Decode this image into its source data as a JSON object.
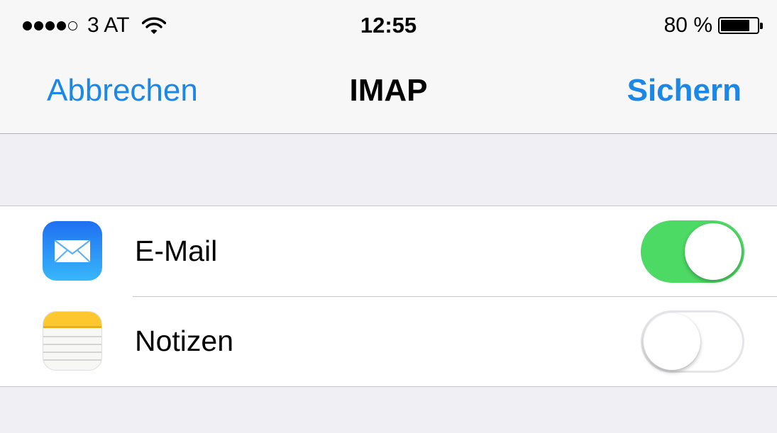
{
  "status_bar": {
    "signal_bars": 5,
    "signal_filled": 4,
    "carrier": "3 AT",
    "wifi_icon": "wifi-icon",
    "time": "12:55",
    "battery_percent": "80 %",
    "battery_level": 0.8
  },
  "nav": {
    "cancel_label": "Abbrechen",
    "title": "IMAP",
    "save_label": "Sichern"
  },
  "settings": [
    {
      "icon": "mail-app-icon",
      "label": "E-Mail",
      "enabled": true
    },
    {
      "icon": "notes-app-icon",
      "label": "Notizen",
      "enabled": false
    }
  ],
  "colors": {
    "accent": "#1b88e8",
    "toggle_on": "#4cd964",
    "background": "#efeff4"
  }
}
